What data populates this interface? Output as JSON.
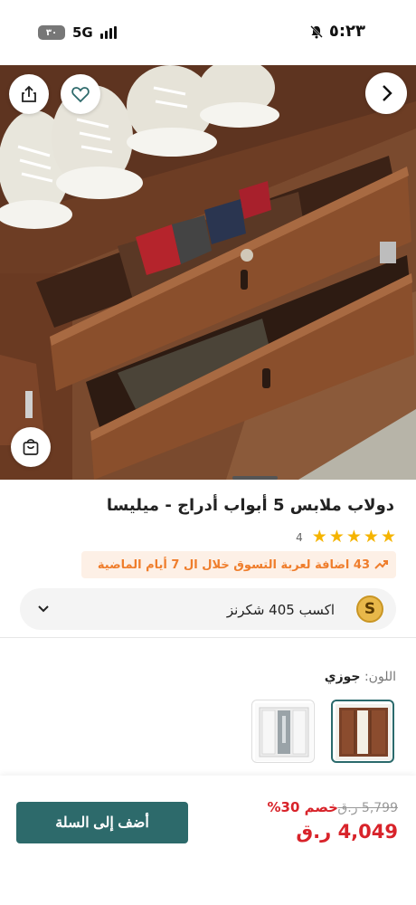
{
  "status_bar": {
    "time": "٥:٢٣",
    "network": "5G",
    "battery": "٣٠"
  },
  "product": {
    "title": "دولاب ملابس 5 أبواب أدراج - ميليسا",
    "rating_count": "4",
    "rating_stars": 5,
    "trend_text": "43 اضافة لعربة التسوق خلال ال 7 أيام الماضية",
    "rewards_text": "اكسب 405 شكرنز",
    "rewards_coin": "S",
    "color_key": "اللون:",
    "color_value": "جوزي",
    "colors": [
      "walnut",
      "white"
    ]
  },
  "pricing": {
    "old_price": "5,799 ر.ق",
    "discount": "خصم 30%",
    "price": "4,049 ر.ق"
  },
  "actions": {
    "add_to_cart": "أضف إلى السلة"
  },
  "icons": {
    "share": "share-icon",
    "favorite": "heart-icon",
    "next": "chevron-right-icon",
    "cart": "shopping-bag-icon",
    "expand": "chevron-down-icon",
    "trend": "trending-up-icon"
  },
  "colors": {
    "accent": "#2d6a6b",
    "sale": "#d8232a",
    "trend": "#ef7d2b",
    "star": "#f5b400"
  }
}
